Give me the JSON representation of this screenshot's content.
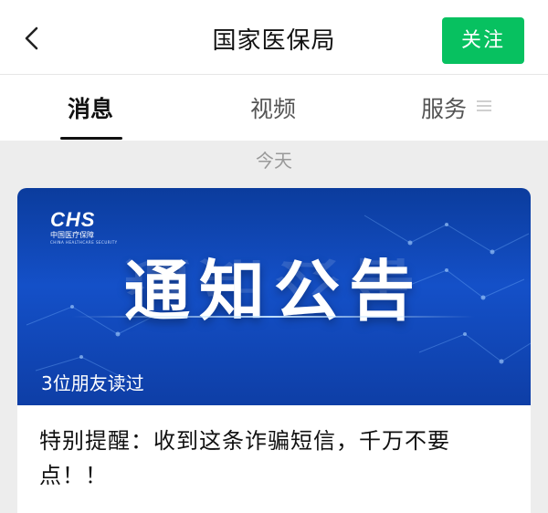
{
  "header": {
    "title": "国家医保局",
    "follow_label": "关注"
  },
  "tabs": [
    {
      "label": "消息",
      "active": true
    },
    {
      "label": "视频",
      "active": false
    },
    {
      "label": "服务",
      "active": false
    }
  ],
  "feed": {
    "date_label": "今天",
    "article": {
      "banner_logo": "CHS",
      "banner_logo_cn": "中国医疗保障",
      "banner_logo_en": "CHINA HEALTHCARE SECURITY",
      "banner_title": "通知公告",
      "read_count_label": "3位朋友读过",
      "headline": "特别提醒：收到这条诈骗短信，千万不要点！！"
    }
  },
  "colors": {
    "accent_green": "#07c160",
    "banner_blue": "#1450c8"
  },
  "icons": {
    "back": "chevron-left-icon",
    "menu": "menu-icon"
  }
}
